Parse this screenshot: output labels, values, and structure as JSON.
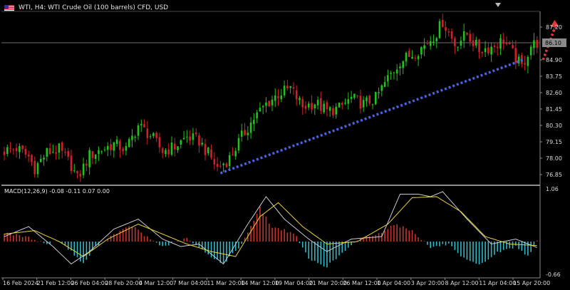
{
  "window": {
    "title": "WTI, H4:  WTI Crude Oil (100 barrels) CFD, USD",
    "flag_icon": "us-flag-icon"
  },
  "indicator": {
    "label": "MACD(12,26,9) -0.08 -0.11 0.07 0.00"
  },
  "chart_data": {
    "type": "candlestick",
    "symbol": "WTI",
    "timeframe": "H4",
    "current_price_label": "86.10",
    "current_price": 86.1,
    "y_ticks": [
      "87.20",
      "84.90",
      "83.75",
      "82.60",
      "81.45",
      "80.30",
      "79.15",
      "78.00",
      "76.85"
    ],
    "x_ticks": [
      "16 Feb 2024",
      "21 Feb 12:00",
      "26 Feb 04:00",
      "28 Feb 20:00",
      "4 Mar 12:00",
      "7 Mar 04:00",
      "11 Mar 20:00",
      "14 Mar 12:00",
      "19 Mar 04:00",
      "21 Mar 20:00",
      "26 Mar 12:00",
      "1 Apr 04:00",
      "3 Apr 20:00",
      "8 Apr 12:00",
      "11 Apr 04:00",
      "15 Apr 20:00"
    ],
    "ylim": [
      76.2,
      88.2
    ],
    "macd_ticks": [
      "1.06",
      "-0.66"
    ],
    "macd_ylim": [
      -0.7,
      1.1
    ],
    "trendline": {
      "start": [
        71,
        76.95
      ],
      "end": [
        171,
        84.95
      ]
    },
    "arrow": {
      "start": [
        177,
        84.9
      ],
      "end": [
        181,
        87.5
      ]
    },
    "anchors": [
      [
        0,
        78.5
      ],
      [
        4,
        78.7
      ],
      [
        8,
        78.1
      ],
      [
        10,
        77.3
      ],
      [
        14,
        78.4
      ],
      [
        18,
        78.6
      ],
      [
        22,
        77.5
      ],
      [
        24,
        76.55
      ],
      [
        28,
        78.2
      ],
      [
        32,
        78.6
      ],
      [
        36,
        79.0
      ],
      [
        40,
        78.6
      ],
      [
        44,
        80.3
      ],
      [
        48,
        79.6
      ],
      [
        52,
        78.5
      ],
      [
        56,
        78.8
      ],
      [
        60,
        79.5
      ],
      [
        64,
        79.2
      ],
      [
        68,
        78.0
      ],
      [
        70,
        77.3
      ],
      [
        74,
        78.0
      ],
      [
        78,
        79.5
      ],
      [
        82,
        80.8
      ],
      [
        86,
        81.8
      ],
      [
        90,
        82.5
      ],
      [
        94,
        82.9
      ],
      [
        98,
        81.6
      ],
      [
        102,
        81.9
      ],
      [
        106,
        81.3
      ],
      [
        110,
        81.5
      ],
      [
        114,
        82.2
      ],
      [
        118,
        81.8
      ],
      [
        122,
        82.2
      ],
      [
        126,
        83.6
      ],
      [
        130,
        84.8
      ],
      [
        134,
        85.3
      ],
      [
        138,
        85.9
      ],
      [
        142,
        86.8
      ],
      [
        144,
        87.6
      ],
      [
        148,
        86.0
      ],
      [
        152,
        86.7
      ],
      [
        156,
        85.6
      ],
      [
        160,
        85.8
      ],
      [
        164,
        86.3
      ],
      [
        168,
        85.0
      ],
      [
        170,
        84.4
      ],
      [
        173,
        85.9
      ],
      [
        175,
        86.1
      ]
    ],
    "macd_anchors": [
      [
        0,
        0.18
      ],
      [
        8,
        0.08
      ],
      [
        14,
        -0.05
      ],
      [
        18,
        0.02
      ],
      [
        22,
        -0.2
      ],
      [
        26,
        -0.45
      ],
      [
        30,
        -0.1
      ],
      [
        36,
        0.15
      ],
      [
        42,
        0.32
      ],
      [
        46,
        0.12
      ],
      [
        52,
        -0.1
      ],
      [
        60,
        0.06
      ],
      [
        66,
        -0.22
      ],
      [
        72,
        -0.45
      ],
      [
        78,
        -0.05
      ],
      [
        84,
        0.68
      ],
      [
        88,
        0.28
      ],
      [
        92,
        0.24
      ],
      [
        96,
        0.1
      ],
      [
        100,
        -0.35
      ],
      [
        106,
        -0.5
      ],
      [
        112,
        -0.18
      ],
      [
        118,
        0.1
      ],
      [
        122,
        0.12
      ],
      [
        128,
        0.35
      ],
      [
        134,
        0.22
      ],
      [
        140,
        -0.12
      ],
      [
        146,
        -0.05
      ],
      [
        150,
        -0.32
      ],
      [
        156,
        -0.48
      ],
      [
        162,
        -0.22
      ],
      [
        168,
        -0.1
      ],
      [
        172,
        -0.28
      ],
      [
        175,
        0.0
      ]
    ],
    "macd_line_anchors": [
      [
        0,
        0.1
      ],
      [
        8,
        0.3
      ],
      [
        16,
        -0.1
      ],
      [
        22,
        -0.45
      ],
      [
        28,
        -0.2
      ],
      [
        36,
        0.25
      ],
      [
        44,
        0.45
      ],
      [
        52,
        0.05
      ],
      [
        58,
        -0.1
      ],
      [
        64,
        -0.05
      ],
      [
        72,
        -0.45
      ],
      [
        80,
        0.35
      ],
      [
        86,
        0.9
      ],
      [
        92,
        0.45
      ],
      [
        100,
        0.05
      ],
      [
        106,
        -0.2
      ],
      [
        114,
        0.05
      ],
      [
        124,
        0.1
      ],
      [
        130,
        0.95
      ],
      [
        136,
        0.95
      ],
      [
        140,
        0.9
      ],
      [
        144,
        1.0
      ],
      [
        152,
        0.45
      ],
      [
        160,
        -0.05
      ],
      [
        168,
        0.05
      ],
      [
        175,
        -0.12
      ]
    ],
    "signal_anchors": [
      [
        0,
        0.15
      ],
      [
        10,
        0.22
      ],
      [
        18,
        0.0
      ],
      [
        26,
        -0.3
      ],
      [
        34,
        0.05
      ],
      [
        44,
        0.35
      ],
      [
        52,
        0.15
      ],
      [
        60,
        -0.05
      ],
      [
        68,
        -0.2
      ],
      [
        76,
        -0.3
      ],
      [
        84,
        0.5
      ],
      [
        90,
        0.78
      ],
      [
        98,
        0.3
      ],
      [
        106,
        -0.05
      ],
      [
        116,
        0.0
      ],
      [
        126,
        0.35
      ],
      [
        134,
        0.88
      ],
      [
        142,
        0.9
      ],
      [
        150,
        0.6
      ],
      [
        158,
        0.1
      ],
      [
        166,
        -0.05
      ],
      [
        175,
        -0.08
      ]
    ],
    "colors": {
      "bull": "#21c21d",
      "bear": "#d2202a",
      "macd_pos": "#c8342f",
      "macd_neg": "#2fb9c6",
      "macd_line": "#c9c9d6",
      "signal_line": "#e8d33a",
      "trendline": "#4a63e0",
      "arrow": "#e03a3a",
      "grid": "#6e6e6e"
    }
  }
}
